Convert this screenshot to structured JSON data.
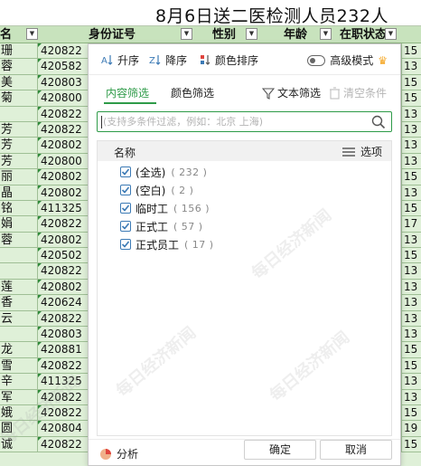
{
  "sheet": {
    "title": "8月6日送二医检测人员232人",
    "headers": {
      "name": "姓名",
      "id": "身份证号",
      "sex": "性别",
      "age": "年龄",
      "job": "在职状态"
    },
    "rows": [
      {
        "name": "珊",
        "id": "420822",
        "right": "15"
      },
      {
        "name": "蓉",
        "id": "420582",
        "right": "13"
      },
      {
        "name": "美",
        "id": "420803",
        "right": "15"
      },
      {
        "name": "菊",
        "id": "420800",
        "right": "15"
      },
      {
        "name": "",
        "id": "420822",
        "right": "13"
      },
      {
        "name": "芳",
        "id": "420822",
        "right": "13"
      },
      {
        "name": "芳",
        "id": "420802",
        "right": "13"
      },
      {
        "name": "芳",
        "id": "420800",
        "right": "13"
      },
      {
        "name": "丽",
        "id": "420802",
        "right": "15"
      },
      {
        "name": "晶",
        "id": "420802",
        "right": "13"
      },
      {
        "name": "铭",
        "id": "411325",
        "right": "15"
      },
      {
        "name": "娟",
        "id": "420822",
        "right": "17"
      },
      {
        "name": "蓉",
        "id": "420802",
        "right": "13"
      },
      {
        "name": "",
        "id": "420502",
        "right": "15"
      },
      {
        "name": "",
        "id": "420822",
        "right": "13"
      },
      {
        "name": "莲",
        "id": "420802",
        "right": "13"
      },
      {
        "name": "香",
        "id": "420624",
        "right": "13"
      },
      {
        "name": "云",
        "id": "420822",
        "right": "13"
      },
      {
        "name": "",
        "id": "420803",
        "right": "13"
      },
      {
        "name": "龙",
        "id": "420881",
        "right": "15"
      },
      {
        "name": "雪",
        "id": "420822",
        "right": "15"
      },
      {
        "name": "辛",
        "id": "411325",
        "right": "13"
      },
      {
        "name": "军",
        "id": "420822",
        "right": "13"
      },
      {
        "name": "娥",
        "id": "420822",
        "right": "15"
      },
      {
        "name": "圆",
        "id": "420804",
        "right": "19"
      },
      {
        "name": "诚",
        "id": "420822",
        "right": "15"
      }
    ]
  },
  "popup": {
    "toolbar": {
      "sort_asc": "升序",
      "sort_desc": "降序",
      "color_sort": "颜色排序",
      "advanced_mode": "高级模式"
    },
    "tabs": {
      "content_filter": "内容筛选",
      "color_filter": "颜色筛选",
      "text_filter": "文本筛选",
      "clear_conditions": "清空条件"
    },
    "search": {
      "placeholder": "(支持多条件过滤，例如：北京 上海)"
    },
    "list": {
      "header_name": "名称",
      "options_label": "选项",
      "items": [
        {
          "label": "(全选)",
          "count": "( 232 )",
          "checked": true
        },
        {
          "label": "(空白)",
          "count": "( 2 )",
          "checked": true
        },
        {
          "label": "临时工",
          "count": "( 156 )",
          "checked": true
        },
        {
          "label": "正式工",
          "count": "( 57 )",
          "checked": true
        },
        {
          "label": "正式员工",
          "count": "( 17 )",
          "checked": true
        }
      ]
    },
    "footer": {
      "analyze": "分析",
      "ok": "确定",
      "cancel": "取消"
    }
  },
  "watermark": "每日经济新闻",
  "colors": {
    "accent_green": "#2e9b48",
    "sheet_green": "#dff0d8",
    "header_green": "#c8e3bd",
    "crown": "#f5a623"
  }
}
